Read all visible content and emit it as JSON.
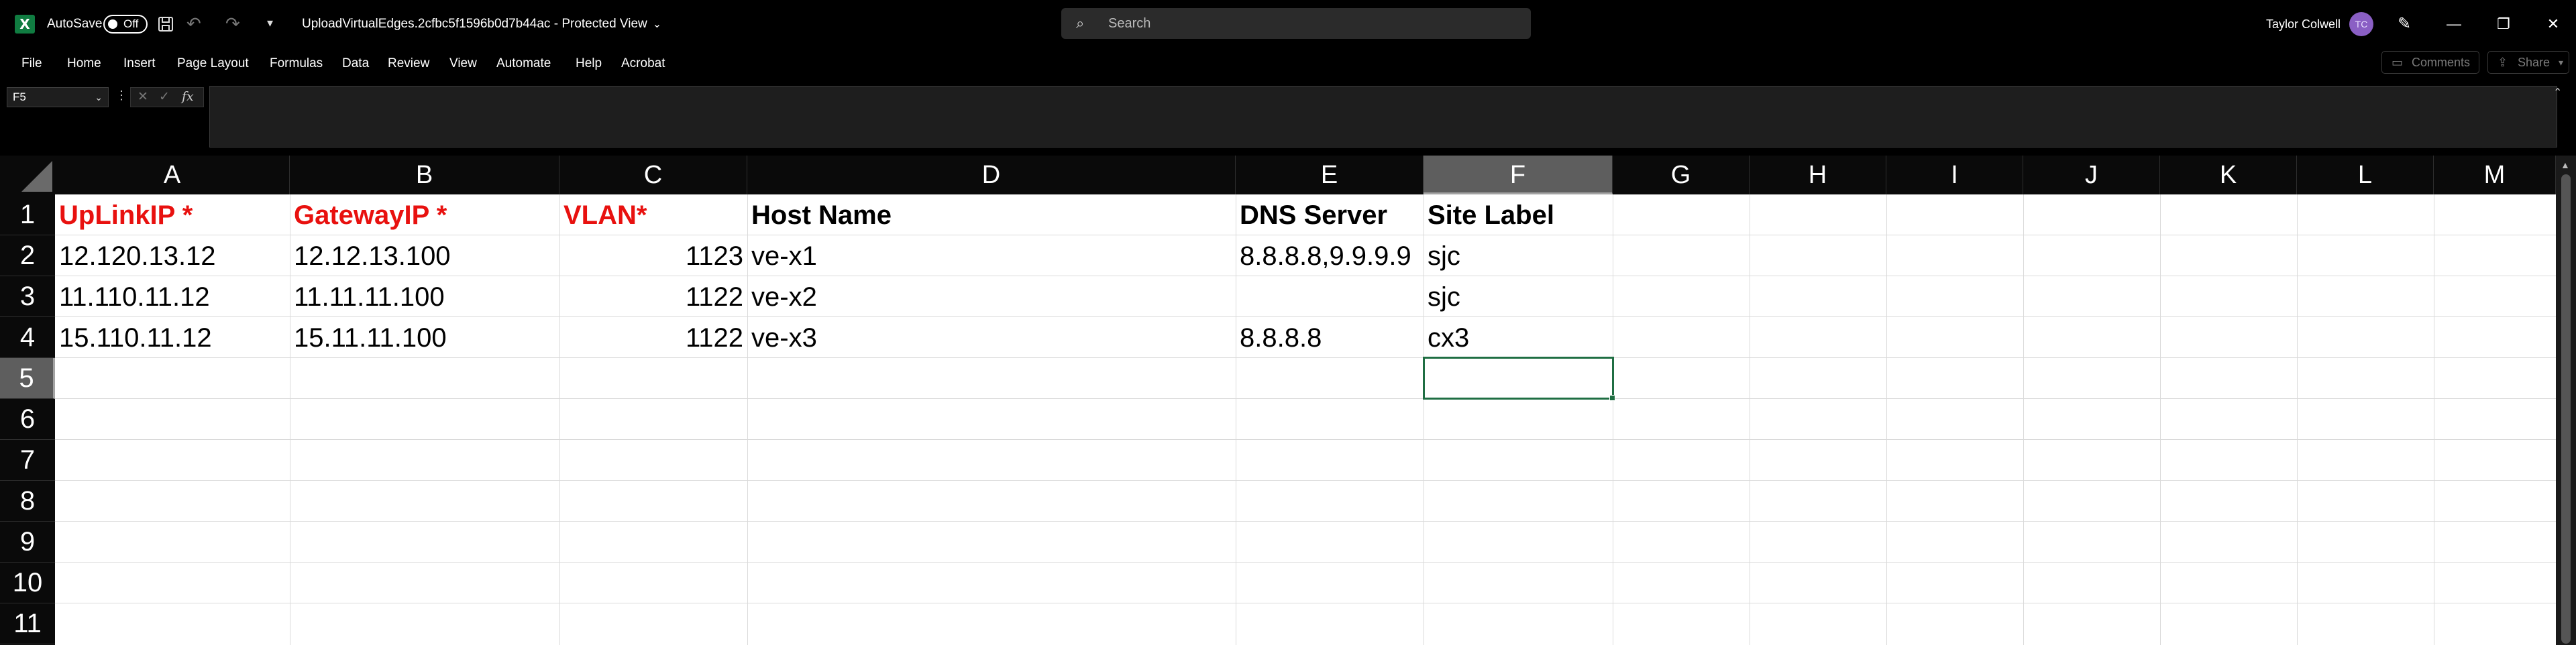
{
  "titlebar": {
    "app_logo": "X",
    "autosave_label": "AutoSave",
    "autosave_state": "Off",
    "filename": "UploadVirtualEdges.2cfbc5f1596b0d7b44ac  -  Protected View",
    "filename_chevron": "⌄",
    "search_placeholder": "Search",
    "user_name": "Taylor Colwell",
    "avatar_initials": "TC"
  },
  "icons": {
    "save": "save-icon",
    "undo": "↶",
    "redo": "↷",
    "more": "▾",
    "search": "⌕",
    "pen": "✎",
    "minimize": "—",
    "restore": "❐",
    "close": "✕"
  },
  "menu": {
    "items": [
      "File",
      "Home",
      "Insert",
      "Page Layout",
      "Formulas",
      "Data",
      "Review",
      "View",
      "Automate",
      "Help",
      "Acrobat"
    ],
    "comments_label": "Comments",
    "share_label": "Share"
  },
  "formula_bar": {
    "name_box": "F5",
    "fx_label": "fx",
    "value": ""
  },
  "sheet": {
    "columns": [
      "A",
      "B",
      "C",
      "D",
      "E",
      "F",
      "G",
      "H",
      "I",
      "J",
      "K",
      "L",
      "M"
    ],
    "rows": [
      "1",
      "2",
      "3",
      "4",
      "5",
      "6",
      "7",
      "8",
      "9",
      "10",
      "11"
    ],
    "selected_cell": "F5",
    "header_row": {
      "A": "UpLinkIP *",
      "B": "GatewayIP *",
      "C": "VLAN*",
      "D": "Host Name",
      "E": "DNS Server",
      "F": "Site Label"
    },
    "data_rows": [
      {
        "A": "12.120.13.12",
        "B": "12.12.13.100",
        "C": "1123",
        "D": "ve-x1",
        "E": "8.8.8.8,9.9.9.9",
        "F": "sjc"
      },
      {
        "A": "11.110.11.12",
        "B": "11.11.11.100",
        "C": "1122",
        "D": "ve-x2",
        "E": "",
        "F": "sjc"
      },
      {
        "A": "15.110.11.12",
        "B": "15.11.11.100",
        "C": "1122",
        "D": "ve-x3",
        "E": "8.8.8.8",
        "F": "cx3"
      }
    ],
    "colors": {
      "required_header": "#e8110f",
      "selection_border": "#1f6e43",
      "selected_header_bg": "#5e5e5e"
    }
  }
}
